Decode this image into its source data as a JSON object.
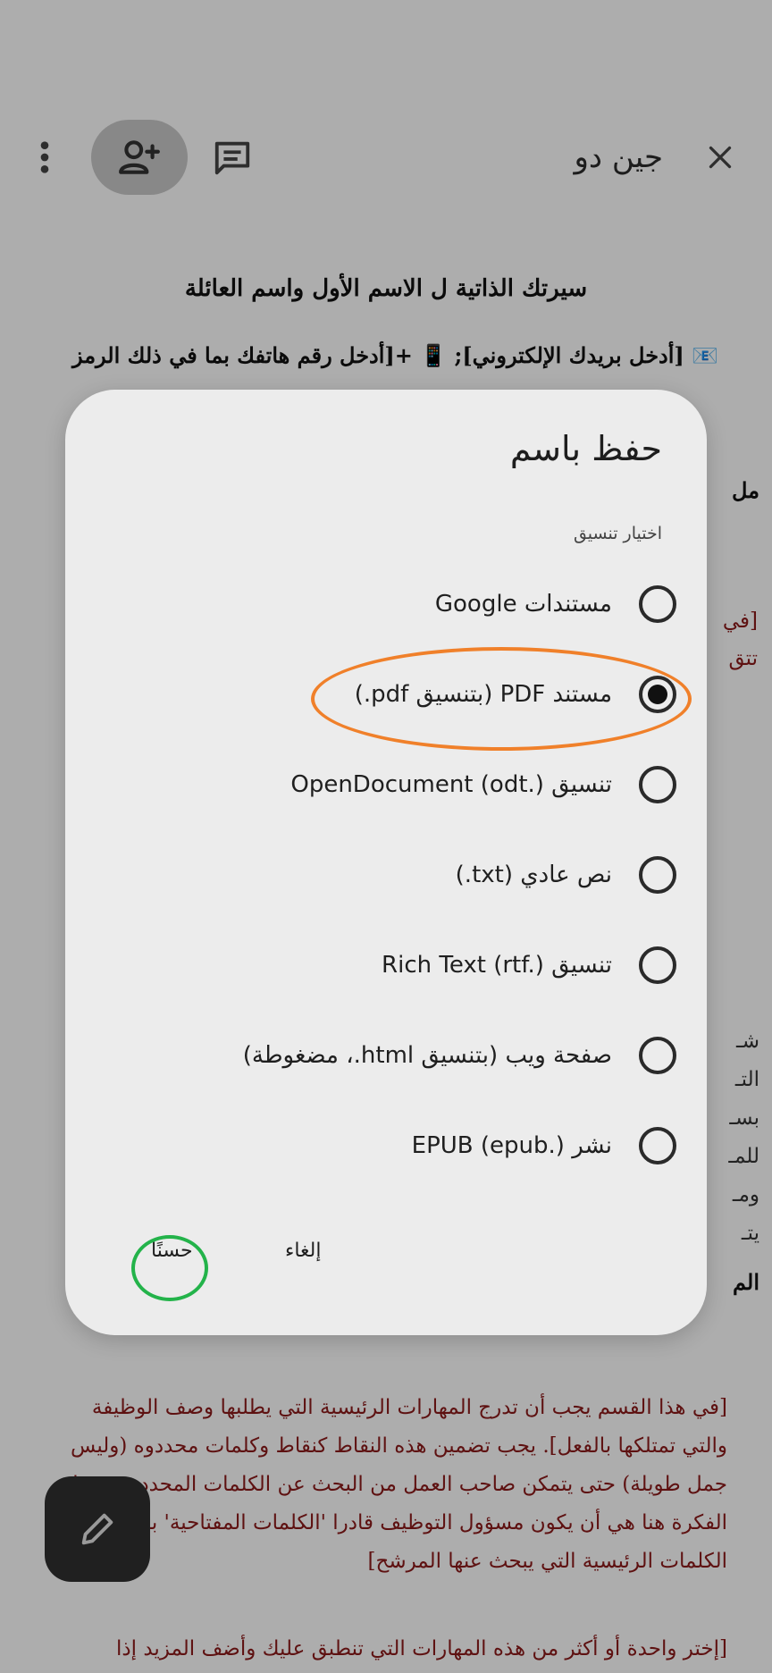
{
  "appbar": {
    "title": "جين دو",
    "close_icon": "close-icon",
    "comment_icon": "comment-icon",
    "share_icon": "add-person-icon",
    "more_icon": "more-vert-icon"
  },
  "document": {
    "heading": "سيرتك الذاتية ل الاسم الأول واسم العائلة",
    "contact_line": "📧 [أدخل بريدك الإلكتروني]; 📱 +[أدخل رقم هاتفك بما في ذلك الرمز",
    "side_heading_1": "مل",
    "side_heading_2": "الم",
    "red_fragment_1": "[في",
    "red_fragment_2": "تتق",
    "gray_fragments": [
      "شـ",
      "التـ",
      "بسـ",
      "للمـ",
      "ومـ",
      "يتـ"
    ],
    "skills_paragraph": "[في هذا القسم يجب أن تدرج المهارات الرئيسية التي يطلبها وصف الوظيفة والتي تمتلكها بالفعل]. يجب تضمين هذه النقاط كنقاط وكلمات محددوه (وليس جمل طويلة) حتى يتمكن صاحب العمل من البحث عن الكلمات المحددة بسهولة. الفكرة هنا هي أن يكون مسؤول التوظيف قادرا 'الكلمات المفتاحية' بسرعة وهي الكلمات الرئيسية التي يبحث عنها المرشح]",
    "last_line": "[إختر واحدة أو أكثر من هذه المهارات التي تنطبق عليك وأضف المزيد إذا"
  },
  "dialog": {
    "title": "حفظ باسم",
    "subtitle": "اختيار تنسيق",
    "options": [
      {
        "label": "مستندات Google",
        "checked": false
      },
      {
        "label": "مستند PDF (بتنسيق pdf.)",
        "checked": true
      },
      {
        "label": "تنسيق OpenDocument (odt.)",
        "checked": false
      },
      {
        "label": "نص عادي (txt.)",
        "checked": false
      },
      {
        "label": "تنسيق Rich Text (rtf.)",
        "checked": false
      },
      {
        "label": "صفحة ويب (بتنسيق html.، مضغوطة)",
        "checked": false
      },
      {
        "label": "نشر EPUB (epub.)",
        "checked": false
      }
    ],
    "cancel_label": "إلغاء",
    "ok_label": "حسنًا",
    "highlight_color": "#f0802a",
    "ok_ring_color": "#23b34a"
  },
  "fab": {
    "icon": "edit-pencil-icon"
  }
}
